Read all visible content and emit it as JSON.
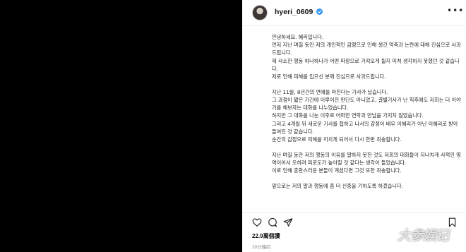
{
  "post": {
    "username": "hyeri_0609",
    "caption_lines": [
      "안녕하세요. 혜리입니다.",
      "먼저 지난 며칠 동안 저의 개인적인 감정으로 인해 생긴 억측과 논란에 대해 진심으로 사과드립니다.",
      "제 사소한 행동 하나하나가 어떤 파장으로 가져오게 될지 미처 생각하지 못했던 것 같습니다.",
      "저로 인해 피해를 입으신 분께 진심으로 사과드립니다.",
      "",
      "지난 11월, 8년간의 연애를 마친다는 기사가 났습니다.",
      "그 과정이 짧은 기간에 이루어진 판단도 아니었고, 결별기사가 난 직후에도 저희는 더 이야기를 해보자는 대화를 나누었습니다.",
      "하지만 그 대화를 나눈 이후로 어떠한 연락과 만남을 가지지 않았습니다.",
      "그리고 4개월 뒤 새로운 기사를 접하고 나서의 감정이 배우 이혜리가 아닌 이혜리로 받아들여진 것 같습니다.",
      "순간의 감정으로 피해를 끼치게 되어서 다시 한번 죄송합니다.",
      "",
      "지난 며칠 동안 저의 행동의 이유를 말하지 못한 것도 저희의 대화들이 지나치게 사적인 영역이어서 오히려 피로도가 높아질 것 같다는 생각이 들었습니다.",
      "이로 인해 혼란스러운 분들이 계셨다면 그것 또한 죄송합니다.",
      "",
      "앞으로는 저의 말과 행동에 좀 더 신중을 기하도록 하겠습니다."
    ],
    "likes": "22.9萬個讚",
    "timestamp": "39分鐘前"
  },
  "icons": {
    "more": "more-options-icon",
    "like": "heart-icon",
    "comment": "comment-icon",
    "share": "share-icon",
    "save": "bookmark-icon",
    "verified": "verified-badge-icon"
  },
  "colors": {
    "verified": "#3897f0",
    "text": "#262626",
    "muted": "#8e8e8e"
  },
  "watermark": "大参娱记"
}
